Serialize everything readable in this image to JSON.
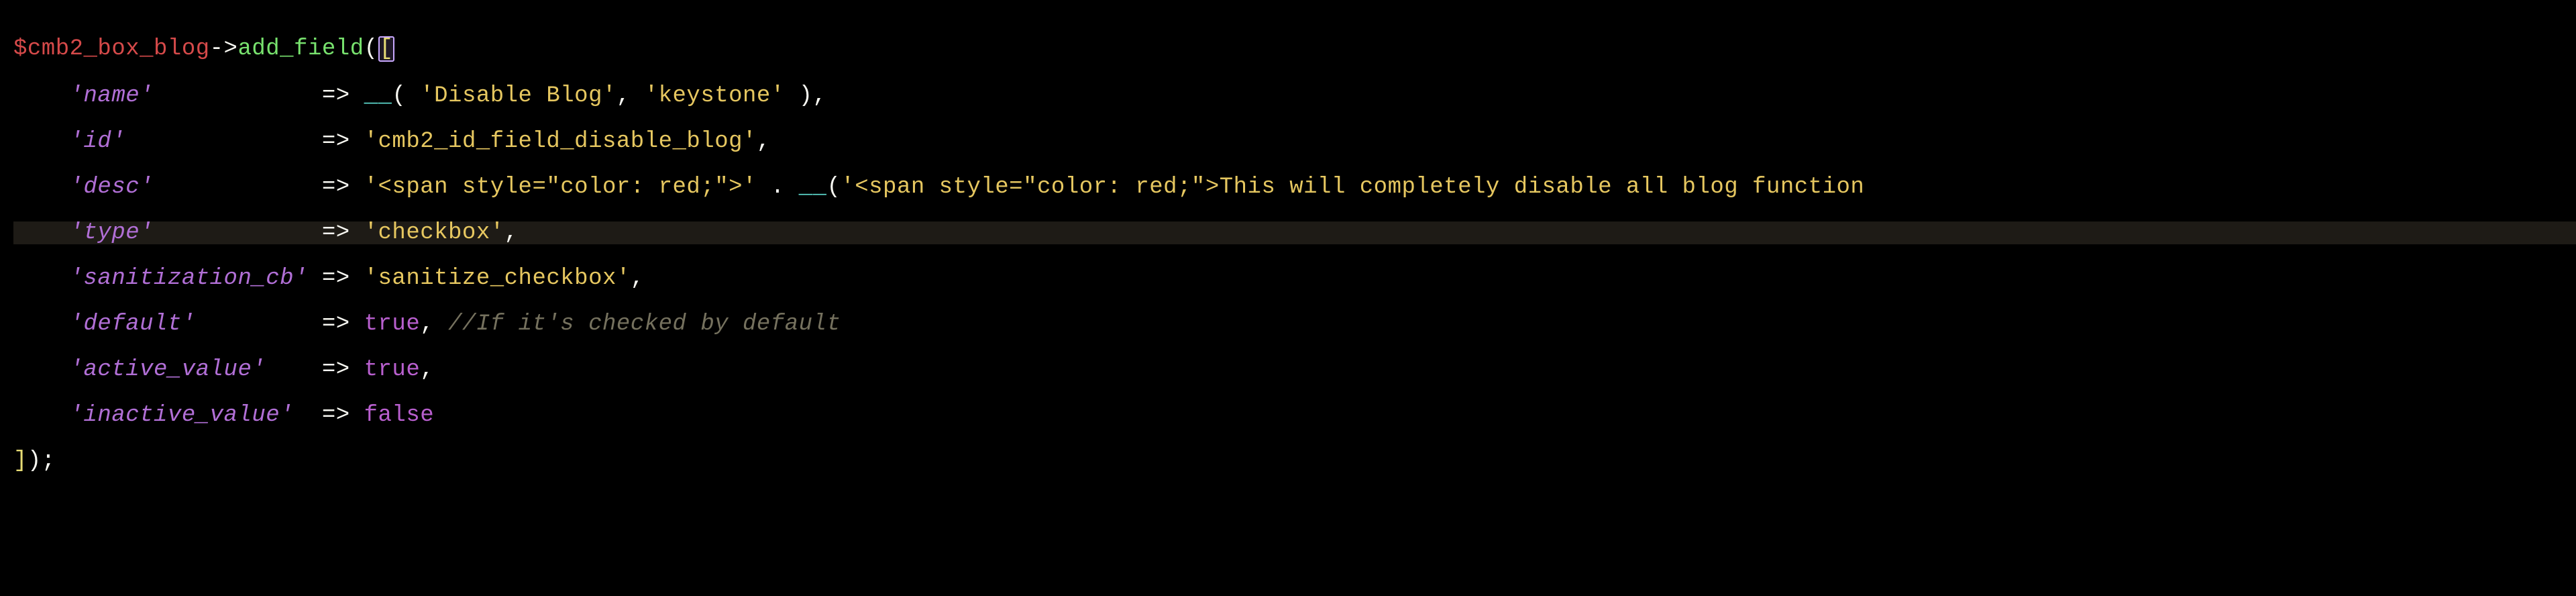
{
  "line1": {
    "var": "$cmb2_box_blog",
    "arrow": "->",
    "method": "add_field",
    "open_paren": "(",
    "open_bracket_cursor": "[",
    "close_bracket_partner": ""
  },
  "rows": {
    "name": {
      "key": "'name'",
      "space": "            ",
      "arrow": "=>",
      "a": " ",
      "fn": "__",
      "b": "( ",
      "s1": "'Disable Blog'",
      "c": ", ",
      "s2": "'keystone'",
      "d": " ),",
      "tail": ""
    },
    "id": {
      "key": "'id'",
      "space": "              ",
      "arrow": "=>",
      "a": " ",
      "s1": "'cmb2_id_field_disable_blog'",
      "tail": ","
    },
    "desc": {
      "key": "'desc'",
      "space": "            ",
      "arrow": "=>",
      "a": " ",
      "s1": "'<span style=\"color: red;\">'",
      "concat": " . ",
      "fn": "__",
      "b": "(",
      "s2": "'<span style=\"color: red;\">This will completely disable all blog function",
      "tail": ""
    },
    "type": {
      "key": "'type'",
      "space": "            ",
      "arrow": "=>",
      "a": " ",
      "s1": "'checkbox'",
      "tail": ","
    },
    "san": {
      "key": "'sanitization_cb'",
      "space": " ",
      "arrow": "=>",
      "a": " ",
      "s1": "'sanitize_checkbox'",
      "tail": ","
    },
    "def": {
      "key": "'default'",
      "space": "         ",
      "arrow": "=>",
      "a": " ",
      "bool": "true",
      "comma": ", ",
      "comment": "//If it's checked by default"
    },
    "act": {
      "key": "'active_value'",
      "space": "    ",
      "arrow": "=>",
      "a": " ",
      "bool": "true",
      "tail": ","
    },
    "inact": {
      "key": "'inactive_value'",
      "space": "  ",
      "arrow": "=>",
      "a": " ",
      "bool": "false",
      "tail": ""
    }
  },
  "last": {
    "close_bracket": "]",
    "tail": ");"
  }
}
